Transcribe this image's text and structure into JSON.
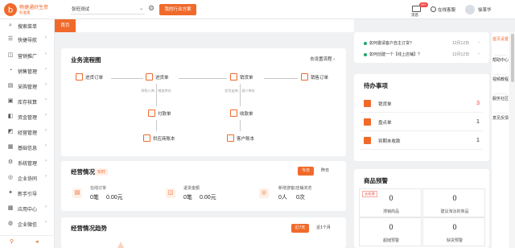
{
  "brand": {
    "name": "畅捷通好生意",
    "sub": "标准版",
    "color": "#f06a2b"
  },
  "header": {
    "company": "张旺测试",
    "recommend_button": "我的行业方案",
    "messages_label": "消息",
    "messages_badge": "99+",
    "service_label": "在线客服",
    "username": "徐某华"
  },
  "sidebar": {
    "items": [
      {
        "label": "搜索菜单",
        "icon": "search-icon"
      },
      {
        "label": "快捷导航",
        "icon": "shortcut-icon"
      },
      {
        "label": "营销推广",
        "icon": "megaphone-icon"
      },
      {
        "label": "销售管理",
        "icon": "sales-icon"
      },
      {
        "label": "采购管理",
        "icon": "cart-icon"
      },
      {
        "label": "库存核算",
        "icon": "box-icon"
      },
      {
        "label": "资金管理",
        "icon": "wallet-icon"
      },
      {
        "label": "经营管理",
        "icon": "chart-icon"
      },
      {
        "label": "基础信息",
        "icon": "database-icon"
      },
      {
        "label": "系统管理",
        "icon": "gear-icon"
      },
      {
        "label": "企业协同",
        "icon": "network-icon"
      },
      {
        "label": "新手引导",
        "icon": "guide-icon"
      },
      {
        "label": "应用中心",
        "icon": "apps-icon"
      },
      {
        "label": "企业微信",
        "icon": "wechat-icon"
      }
    ]
  },
  "tabs": {
    "home": "首页"
  },
  "notices": [
    {
      "text": "如何邀请客户自主订货?",
      "date": "12月12日"
    },
    {
      "text": "如何创建一个【线上店铺】?",
      "date": "12月12日"
    }
  ],
  "flow": {
    "title": "业务流程图",
    "settings": "去设置流程",
    "nodes": {
      "purchase_order": "进货订单",
      "purchase_in": "进货单",
      "payment": "付款单",
      "supplier_ledger": "供应商账本",
      "sales_out": "销货单",
      "sales_order": "销售订单",
      "receipt": "收款单",
      "customer_ledger": "客户账本"
    },
    "notes": {
      "purchase": "采购入库、增加库存",
      "sales": "发货出库、减少库存"
    }
  },
  "status": {
    "title": "经营情况",
    "hint": "实时",
    "today": "今日",
    "yesterday": "昨日",
    "items": [
      {
        "label": "在线订单",
        "count": "0笔",
        "amount": "0.00元"
      },
      {
        "label": "退货金额",
        "count": "0笔",
        "amount": "0.00元"
      },
      {
        "label": "新增游客/店铺浏览",
        "count": "0人",
        "amount": "0次"
      }
    ]
  },
  "trend": {
    "title": "经营情况趋势",
    "seven_days": "近7天",
    "month": "近1个月"
  },
  "todo": {
    "title": "待办事项",
    "items": [
      {
        "label": "销货单",
        "count": "3"
      },
      {
        "label": "盘点单",
        "count": "1"
      },
      {
        "label": "到期未收款",
        "count": "1"
      }
    ]
  },
  "warning": {
    "title": "商品预警",
    "tag": "去处理",
    "items": [
      {
        "value": "0",
        "label": "滞销商品"
      },
      {
        "value": "0",
        "label": "建议淘汰的商品"
      },
      {
        "value": "0",
        "label": "超储预警"
      },
      {
        "value": "0",
        "label": "缺货预警"
      }
    ]
  },
  "rail": {
    "items": [
      "首页设置",
      "帮助中心",
      "视频教程",
      "服务社区",
      "意见反馈"
    ]
  }
}
